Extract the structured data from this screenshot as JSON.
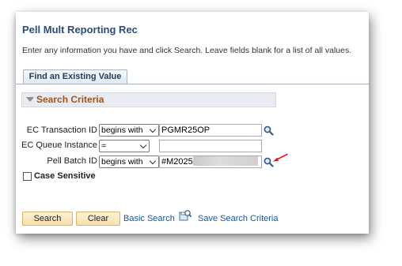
{
  "page": {
    "title": "Pell Mult Reporting Rec",
    "instructions": "Enter any information you have and click Search. Leave fields blank for a list of all values."
  },
  "tabs": [
    {
      "label": "Find an Existing Value"
    }
  ],
  "search_criteria": {
    "label": "Search Criteria",
    "fields": [
      {
        "label": "EC Transaction ID",
        "operator": "begins with",
        "value": "PGMR25OP",
        "has_lookup": true
      },
      {
        "label": "EC Queue Instance",
        "operator": "=",
        "value": "",
        "has_lookup": false
      },
      {
        "label": "Pell Batch ID",
        "operator": "begins with",
        "value": "#M2025",
        "value_redacted": true,
        "has_lookup": true
      }
    ],
    "case_sensitive": {
      "label": "Case Sensitive",
      "checked": false
    }
  },
  "actions": {
    "search_label": "Search",
    "clear_label": "Clear",
    "basic_search_label": "Basic Search",
    "save_search_label": "Save Search Criteria"
  },
  "icons": {
    "lookup": "magnifier-icon",
    "save_search": "save-search-icon",
    "annotation": "red-arrow-icon"
  },
  "colors": {
    "title": "#2a4c7d",
    "criteria_label": "#a0521b",
    "link": "#1a56a0",
    "button_bg": "#f7dfaa",
    "annotation_arrow": "#e01818"
  }
}
